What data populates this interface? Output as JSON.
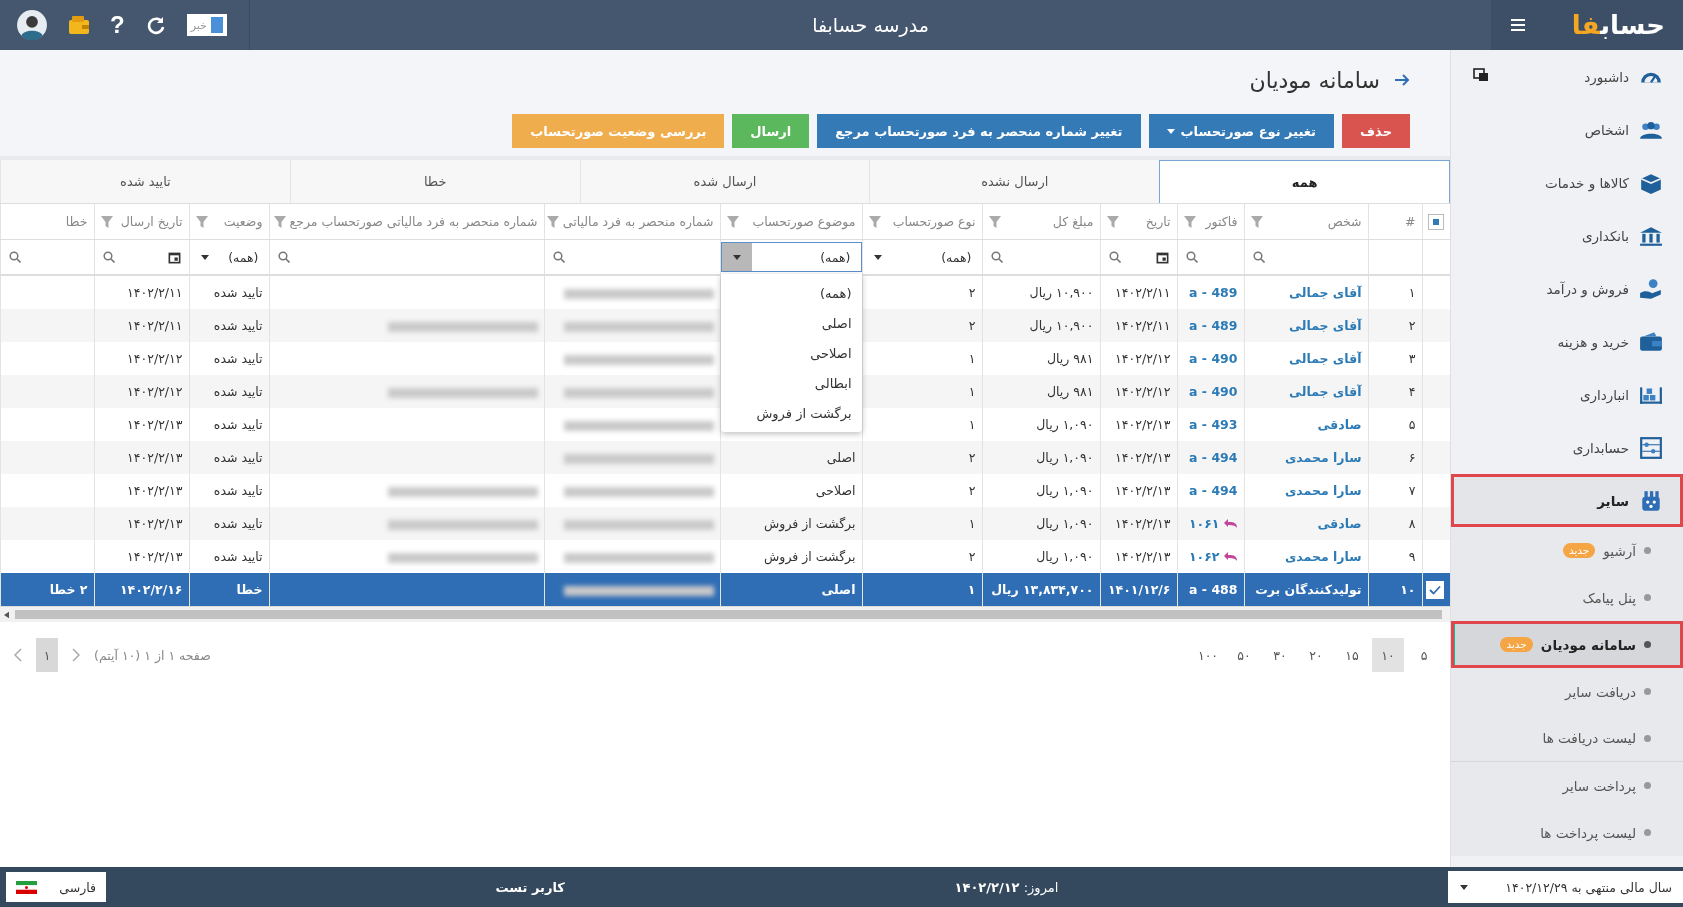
{
  "header": {
    "news_label": "خبر",
    "help_glyph": "?",
    "title": "مدرسه حسابفا",
    "logo": {
      "main": "حساب",
      "accent": "فا"
    }
  },
  "page": {
    "title": "سامانه موديان"
  },
  "buttons": [
    {
      "label": "حذف",
      "kind": "danger",
      "dropdown": false
    },
    {
      "label": "تغییر نوع صورتحساب",
      "kind": "primary",
      "dropdown": true
    },
    {
      "label": "تغییر شماره منحصر به فرد صورتحساب مرجع",
      "kind": "primary",
      "dropdown": false
    },
    {
      "label": "ارسال",
      "kind": "success",
      "dropdown": false
    },
    {
      "label": "بررسی وضعیت صورتحساب",
      "kind": "warning",
      "dropdown": false
    }
  ],
  "tabs": [
    {
      "label": "همه",
      "selected": true
    },
    {
      "label": "ارسال نشده",
      "selected": false
    },
    {
      "label": "ارسال شده",
      "selected": false
    },
    {
      "label": "خطا",
      "selected": false
    },
    {
      "label": "تایید شده",
      "selected": false
    }
  ],
  "table": {
    "columns": [
      {
        "kind": "check",
        "indeterminate": true,
        "filter": {
          "kind": "none"
        }
      },
      {
        "label": "#",
        "funnel": false,
        "filter": {
          "kind": "none"
        }
      },
      {
        "label": "شخص",
        "funnel": true,
        "filter": {
          "kind": "search"
        }
      },
      {
        "label": "فاکتور",
        "funnel": true,
        "filter": {
          "kind": "search"
        }
      },
      {
        "label": "تاریخ",
        "funnel": true,
        "filter": {
          "kind": "date"
        }
      },
      {
        "label": "مبلغ کل",
        "funnel": true,
        "filter": {
          "kind": "search"
        }
      },
      {
        "label": "نوع صورتحساب",
        "funnel": true,
        "filter": {
          "kind": "select",
          "value": "(همه)",
          "open": false
        }
      },
      {
        "label": "موضوع صورتحساب",
        "funnel": true,
        "filter": {
          "kind": "select",
          "value": "(همه)",
          "open": true,
          "options": [
            "(همه)",
            "اصلی",
            "اصلاحی",
            "ابطالی",
            "برگشت از فروش"
          ]
        }
      },
      {
        "label": "شماره منحصر به فرد مالیاتی",
        "funnel": true,
        "filter": {
          "kind": "search"
        }
      },
      {
        "label": "شماره منحصر به فرد مالیاتی صورتحساب مرجع",
        "funnel": true,
        "filter": {
          "kind": "search"
        }
      },
      {
        "label": "وضعیت",
        "funnel": true,
        "filter": {
          "kind": "select",
          "value": "(همه)",
          "open": false
        }
      },
      {
        "label": "تاریخ ارسال",
        "funnel": true,
        "filter": {
          "kind": "date"
        }
      },
      {
        "label": "خطا",
        "funnel": false,
        "filter": {
          "kind": "search"
        }
      }
    ],
    "rows": [
      {
        "selected": false,
        "num": "۱",
        "person": "آقای جمالی",
        "returned": false,
        "invoice": "a - 489",
        "date": "۱۴۰۲/۲/۱۱",
        "amount": "۱۰,۹۰۰ ریال",
        "type": "۲",
        "tax_id_blurred": true,
        "ref_blurred": false,
        "status": "تایید شده",
        "sent_date": "۱۴۰۲/۲/۱۱"
      },
      {
        "selected": false,
        "num": "۲",
        "person": "آقای جمالی",
        "returned": false,
        "invoice": "a - 489",
        "date": "۱۴۰۲/۲/۱۱",
        "amount": "۱۰,۹۰۰ ریال",
        "type": "۲",
        "tax_id_blurred": true,
        "ref_blurred": true,
        "status": "تایید شده",
        "sent_date": "۱۴۰۲/۲/۱۱"
      },
      {
        "selected": false,
        "num": "۳",
        "person": "آقای جمالی",
        "returned": false,
        "invoice": "a - 490",
        "date": "۱۴۰۲/۲/۱۲",
        "amount": "۹۸۱ ریال",
        "type": "۱",
        "tax_id_blurred": true,
        "ref_blurred": false,
        "status": "تایید شده",
        "sent_date": "۱۴۰۲/۲/۱۲"
      },
      {
        "selected": false,
        "num": "۴",
        "person": "آقای جمالی",
        "returned": false,
        "invoice": "a - 490",
        "date": "۱۴۰۲/۲/۱۲",
        "amount": "۹۸۱ ریال",
        "type": "۱",
        "tax_id_blurred": true,
        "ref_blurred": true,
        "status": "تایید شده",
        "sent_date": "۱۴۰۲/۲/۱۲"
      },
      {
        "selected": false,
        "num": "۵",
        "person": "صادقی",
        "returned": false,
        "invoice": "a - 493",
        "date": "۱۴۰۲/۲/۱۳",
        "amount": "۱,۰۹۰ ریال",
        "type": "۱",
        "tax_id_blurred": true,
        "ref_blurred": false,
        "status": "تایید شده",
        "sent_date": "۱۴۰۲/۲/۱۳"
      },
      {
        "selected": false,
        "num": "۶",
        "person": "سارا محمدی",
        "returned": false,
        "invoice": "a - 494",
        "date": "۱۴۰۲/۲/۱۳",
        "amount": "۱,۰۹۰ ریال",
        "type": "۲",
        "subject": "اصلی",
        "tax_id_blurred": true,
        "ref_blurred": false,
        "status": "تایید شده",
        "sent_date": "۱۴۰۲/۲/۱۳"
      },
      {
        "selected": false,
        "num": "۷",
        "person": "سارا محمدی",
        "returned": false,
        "invoice": "a - 494",
        "date": "۱۴۰۲/۲/۱۳",
        "amount": "۱,۰۹۰ ریال",
        "type": "۲",
        "subject": "اصلاحی",
        "tax_id_blurred": true,
        "ref_blurred": true,
        "status": "تایید شده",
        "sent_date": "۱۴۰۲/۲/۱۳"
      },
      {
        "selected": false,
        "num": "۸",
        "person": "صادقی",
        "returned": true,
        "invoice": "۱۰۶۱",
        "date": "۱۴۰۲/۲/۱۳",
        "amount": "۱,۰۹۰ ریال",
        "type": "۱",
        "subject": "برگشت از فروش",
        "tax_id_blurred": true,
        "ref_blurred": true,
        "status": "تایید شده",
        "sent_date": "۱۴۰۲/۲/۱۳"
      },
      {
        "selected": false,
        "num": "۹",
        "person": "سارا محمدی",
        "returned": true,
        "invoice": "۱۰۶۲",
        "date": "۱۴۰۲/۲/۱۳",
        "amount": "۱,۰۹۰ ریال",
        "type": "۲",
        "subject": "برگشت از فروش",
        "tax_id_blurred": true,
        "ref_blurred": true,
        "status": "تایید شده",
        "sent_date": "۱۴۰۲/۲/۱۳"
      },
      {
        "selected": true,
        "num": "۱۰",
        "person": "تولیدکنندگان برت",
        "returned": false,
        "invoice": "a - 488",
        "date": "۱۴۰۱/۱۲/۶",
        "amount": "۱۳,۸۳۴,۷۰۰ ریال",
        "type": "۱",
        "subject": "اصلی",
        "tax_id_blurred": true,
        "ref_blurred": false,
        "status": "خطا",
        "sent_date": "۱۴۰۲/۲/۱۶",
        "error": "۲ خطا"
      }
    ]
  },
  "pager": {
    "sizes": [
      {
        "label": "۵",
        "selected": false
      },
      {
        "label": "۱۰",
        "selected": true
      },
      {
        "label": "۱۵",
        "selected": false
      },
      {
        "label": "۲۰",
        "selected": false
      },
      {
        "label": "۳۰",
        "selected": false
      },
      {
        "label": "۵۰",
        "selected": false
      },
      {
        "label": "۱۰۰",
        "selected": false
      }
    ],
    "summary": "صفحه ۱ از ۱ (۱۰ آیتم)",
    "pages": [
      {
        "label": "۱",
        "selected": true
      }
    ]
  },
  "sidebar": {
    "items": [
      {
        "label": "داشبورد",
        "expanded": false,
        "highlighted": false
      },
      {
        "label": "اشخاص",
        "expanded": false,
        "highlighted": false
      },
      {
        "label": "کالاها و خدمات",
        "expanded": false,
        "highlighted": false
      },
      {
        "label": "بانکداری",
        "expanded": false,
        "highlighted": false
      },
      {
        "label": "فروش و درآمد",
        "expanded": false,
        "highlighted": false
      },
      {
        "label": "خرید و هزینه",
        "expanded": false,
        "highlighted": false
      },
      {
        "label": "انبارداری",
        "expanded": false,
        "highlighted": false
      },
      {
        "label": "حسابداری",
        "expanded": false,
        "highlighted": false
      },
      {
        "label": "سایر",
        "expanded": true,
        "highlighted": true,
        "children": [
          {
            "label": "آرشیو",
            "badge": "جدید",
            "selected": false,
            "highlighted": false,
            "separator": false
          },
          {
            "label": "پنل پیامک",
            "selected": false,
            "highlighted": false,
            "separator": false
          },
          {
            "label": "سامانه مودیان",
            "badge": "جدید",
            "selected": true,
            "highlighted": true,
            "separator": false
          },
          {
            "label": "دریافت سایر",
            "selected": false,
            "highlighted": false,
            "separator": false
          },
          {
            "label": "لیست دریافت ها",
            "selected": false,
            "highlighted": false,
            "separator": true
          },
          {
            "label": "پرداخت سایر",
            "selected": false,
            "highlighted": false,
            "separator": false
          },
          {
            "label": "لیست پرداخت ها",
            "selected": false,
            "highlighted": false,
            "separator": false
          }
        ]
      }
    ]
  },
  "footer": {
    "fiscal_year": "سال مالی منتهی به ۱۴۰۲/۱۲/۲۹",
    "today_label": "امروز:",
    "today": "۱۴۰۲/۲/۱۲",
    "user": "کاربر تست",
    "language": "فارسی"
  }
}
